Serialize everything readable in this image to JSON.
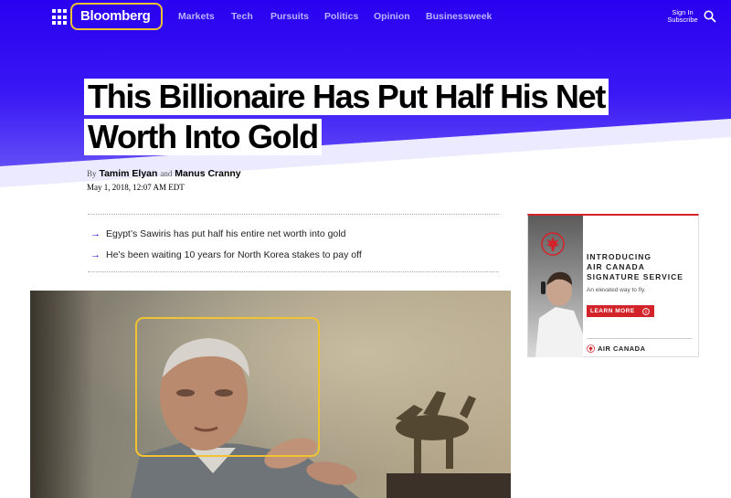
{
  "nav": {
    "logo": "Bloomberg",
    "items": [
      "Markets",
      "Tech",
      "Pursuits",
      "Politics",
      "Opinion",
      "Businessweek"
    ],
    "sign_in": "Sign In",
    "subscribe": "Subscribe"
  },
  "article": {
    "headline_line1": "This Billionaire Has Put Half His Net",
    "headline_line2": "Worth Into Gold",
    "by": "By",
    "author1": "Tamim Elyan",
    "and": "and",
    "author2": "Manus Cranny",
    "date": "May 1, 2018, 12:07 AM EDT",
    "summary": [
      "Egypt’s Sawiris has put half his entire net worth into gold",
      "He’s been waiting 10 years for North Korea stakes to pay off"
    ],
    "arrow": "→"
  },
  "ad": {
    "headline_line1": "INTRODUCING",
    "headline_line2": "AIR CANADA",
    "headline_line3": "SIGNATURE SERVICE",
    "subtext": "An elevated way to fly.",
    "button": "LEARN MORE",
    "brand": "AIR CANADA"
  },
  "colors": {
    "brand_blue": "#2800d7",
    "highlight": "#f1c232",
    "ad_red": "#d2232a"
  },
  "icons": [
    "grid-icon",
    "search-icon",
    "arrow-right-icon",
    "maple-leaf-icon",
    "info-icon"
  ]
}
